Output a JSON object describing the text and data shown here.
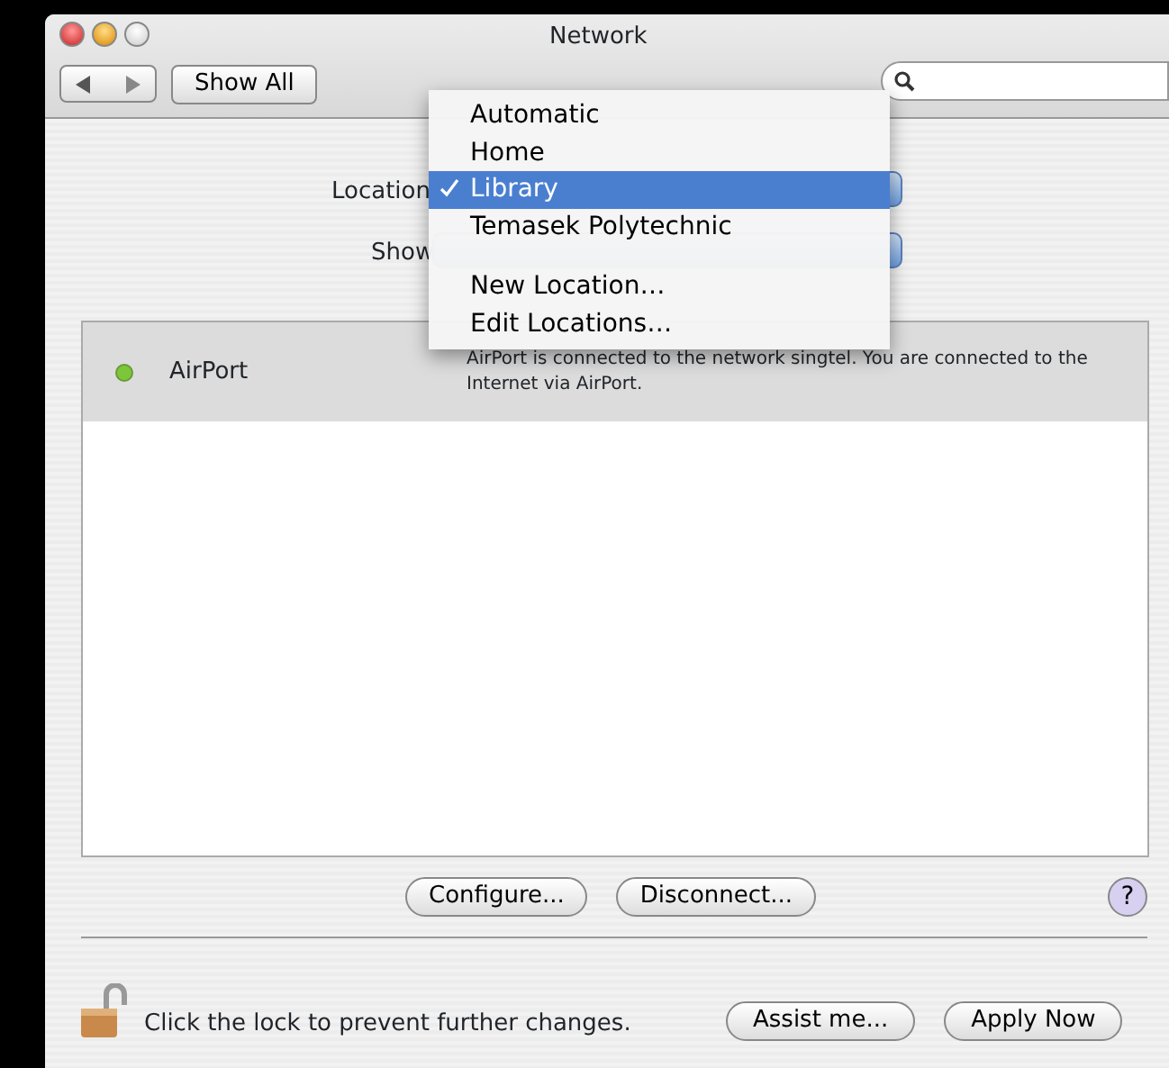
{
  "window": {
    "title": "Network",
    "traffic_lights": [
      {
        "kind": "close"
      },
      {
        "kind": "minimize"
      },
      {
        "kind": "zoom"
      }
    ]
  },
  "toolbar": {
    "show_all": "Show All"
  },
  "location": {
    "label": "Location"
  },
  "show": {
    "label": "Show"
  },
  "menu": {
    "items": [
      {
        "kind": "item",
        "label": "Automatic",
        "selected": false
      },
      {
        "kind": "item",
        "label": "Home",
        "selected": false
      },
      {
        "kind": "item",
        "label": "Library",
        "selected": true
      },
      {
        "kind": "item",
        "label": "Temasek Polytechnic",
        "selected": false
      },
      {
        "kind": "separator"
      },
      {
        "kind": "item",
        "label": "New Location…",
        "selected": false
      },
      {
        "kind": "item",
        "label": "Edit Locations…",
        "selected": false
      }
    ]
  },
  "services": [
    {
      "name": "AirPort",
      "color": "#7cc63a",
      "selected": true,
      "description": "AirPort is connected to the network singtel. You are connected to the Internet via AirPort."
    }
  ],
  "buttons": [
    "Configure...",
    "Disconnect..."
  ],
  "help": "?",
  "lock_text": "Click the lock to prevent further changes.",
  "footer_buttons": [
    "Assist me...",
    "Apply Now"
  ]
}
